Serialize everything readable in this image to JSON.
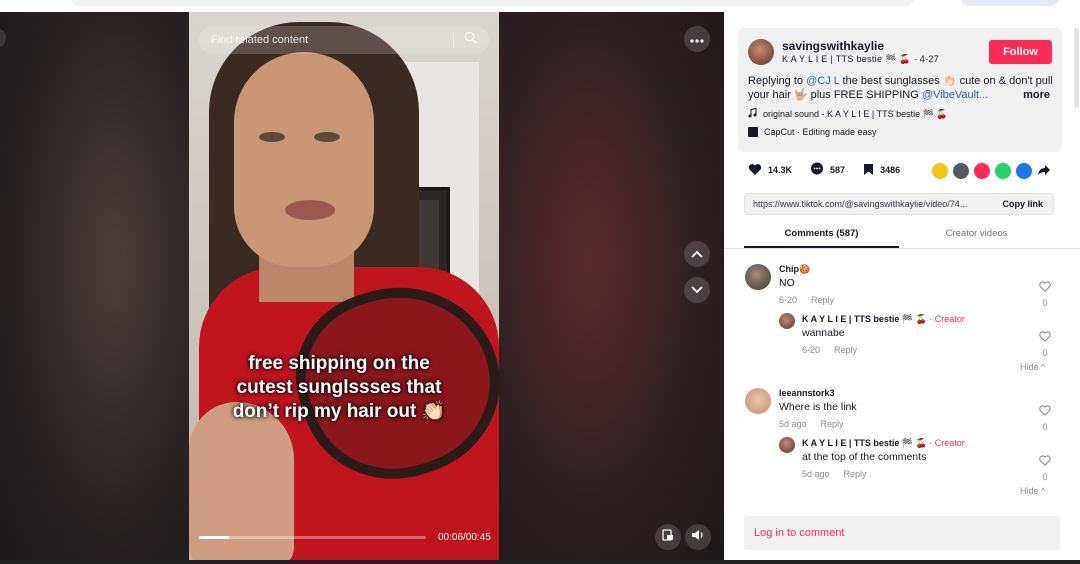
{
  "player": {
    "search_placeholder": "Find related content",
    "caption_lines": [
      "free shipping on the",
      "cutest sunglssses that",
      "don’t rip my hair out 👏🏻"
    ],
    "time": "00:06/00:45",
    "progress_fraction": 0.133
  },
  "post": {
    "username": "savingswithkaylie",
    "display_name": "K A Y L I E | TTS bestie 🏁 🍒",
    "date": "· 4-27",
    "follow_label": "Follow",
    "desc_prefix": "Replying to ",
    "desc_mention": "@CJ L",
    "desc_body": " the best sunglasses 👏🏻 cute on & don't pull your hair 🤟🏼 plus FREE SHIPPING ",
    "desc_tag": "@VibeVault...",
    "more_label": "more",
    "sound": "original sound - K A Y L I E | TTS bestie 🏁 🍒",
    "capcut": "CapCut · Editing made easy",
    "likes": "14.3K",
    "comments_count": "587",
    "saves": "3486",
    "share_colors": [
      "#f5c518",
      "#55585f",
      "#fe2c55",
      "#25d366",
      "#1877f2"
    ],
    "link_url": "https://www.tiktok.com/@savingswithkaylie/video/74...",
    "copy_label": "Copy link"
  },
  "tabs": {
    "comments": "Comments (587)",
    "creator": "Creator videos"
  },
  "comments": [
    {
      "name": "Chip🍪",
      "text": "NO",
      "date": "6-20",
      "reply": "Reply",
      "likes": "0",
      "replies": [
        {
          "name": "K A Y L I E | TTS bestie 🏁 🍒",
          "tag": " · Creator",
          "text": "wannabe",
          "date": "6-20",
          "reply": "Reply",
          "likes": "0"
        }
      ],
      "hide": "Hide ^"
    },
    {
      "name": "leeannstork3",
      "text": "Where is the link",
      "date": "5d ago",
      "reply": "Reply",
      "likes": "0",
      "replies": [
        {
          "name": "K A Y L I E | TTS bestie 🏁 🍒",
          "tag": " · Creator",
          "text": "at the top of the comments",
          "date": "5d ago",
          "reply": "Reply",
          "likes": "0"
        }
      ],
      "hide": "Hide ^"
    }
  ],
  "login_label": "Log in to comment",
  "icons": {
    "heart": "heart-icon",
    "comment": "comment-icon",
    "bookmark": "bookmark-icon",
    "music": "music-note-icon",
    "capcut": "capcut-icon",
    "search": "search-icon",
    "more": "more-horizontal-icon",
    "up": "chevron-up-icon",
    "down": "chevron-down-icon",
    "volume": "volume-icon"
  }
}
